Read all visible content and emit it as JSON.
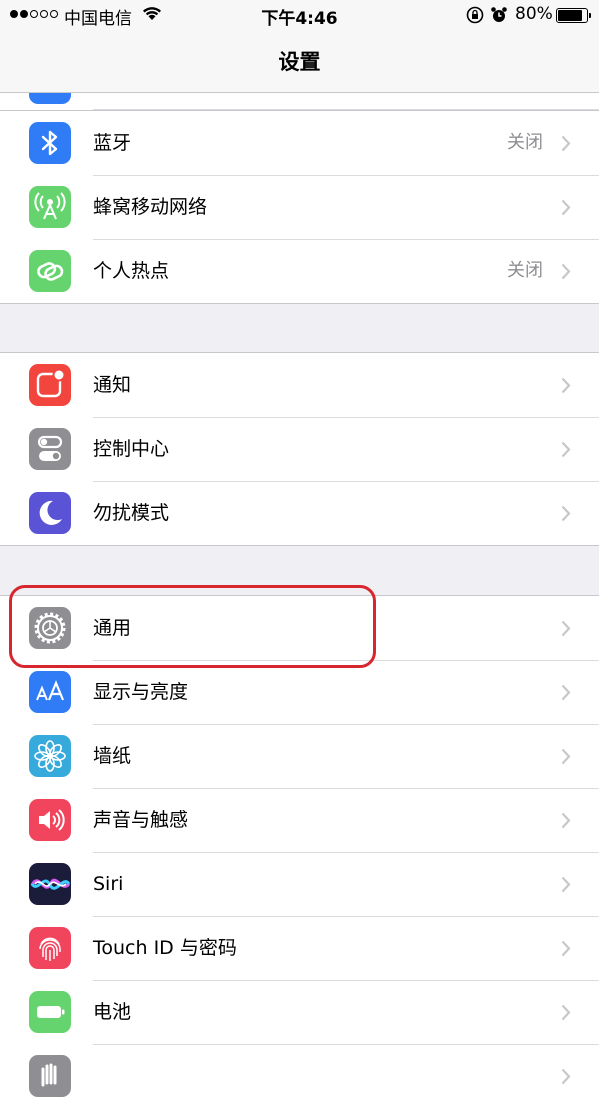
{
  "status": {
    "carrier": "中国电信",
    "time": "下午4:46",
    "battery_percent": "80%",
    "battery_level": 0.8,
    "signal_bars": 2
  },
  "nav": {
    "title": "设置"
  },
  "group1": {
    "bluetooth": {
      "label": "蓝牙",
      "detail": "关闭",
      "icon": "bluetooth-icon",
      "color": "#2f7cf6"
    },
    "cellular": {
      "label": "蜂窝移动网络",
      "icon": "cellular-antenna-icon",
      "color": "#65d36e"
    },
    "hotspot": {
      "label": "个人热点",
      "detail": "关闭",
      "icon": "hotspot-link-icon",
      "color": "#65d36e"
    }
  },
  "group2": {
    "notifications": {
      "label": "通知",
      "icon": "notifications-icon",
      "color": "#f1453d"
    },
    "control_center": {
      "label": "控制中心",
      "icon": "control-center-icon",
      "color": "#8e8e93"
    },
    "dnd": {
      "label": "勿扰模式",
      "icon": "moon-icon",
      "color": "#5b53d6"
    }
  },
  "group3": {
    "general": {
      "label": "通用",
      "icon": "gear-icon",
      "color": "#8e8e93"
    },
    "display": {
      "label": "显示与亮度",
      "icon": "text-size-icon",
      "color": "#2f7cf6"
    },
    "wallpaper": {
      "label": "墙纸",
      "icon": "flower-icon",
      "color": "#37aadc"
    },
    "sounds": {
      "label": "声音与触感",
      "icon": "speaker-icon",
      "color": "#f1445d"
    },
    "siri": {
      "label": "Siri",
      "icon": "siri-icon",
      "color": "#1b1b3a"
    },
    "touchid": {
      "label": "Touch ID 与密码",
      "icon": "fingerprint-icon",
      "color": "#f1445d"
    },
    "battery": {
      "label": "电池",
      "icon": "battery-icon",
      "color": "#65d36e"
    },
    "privacy": {
      "icon": "hand-icon",
      "color": "#8e8e93"
    }
  }
}
